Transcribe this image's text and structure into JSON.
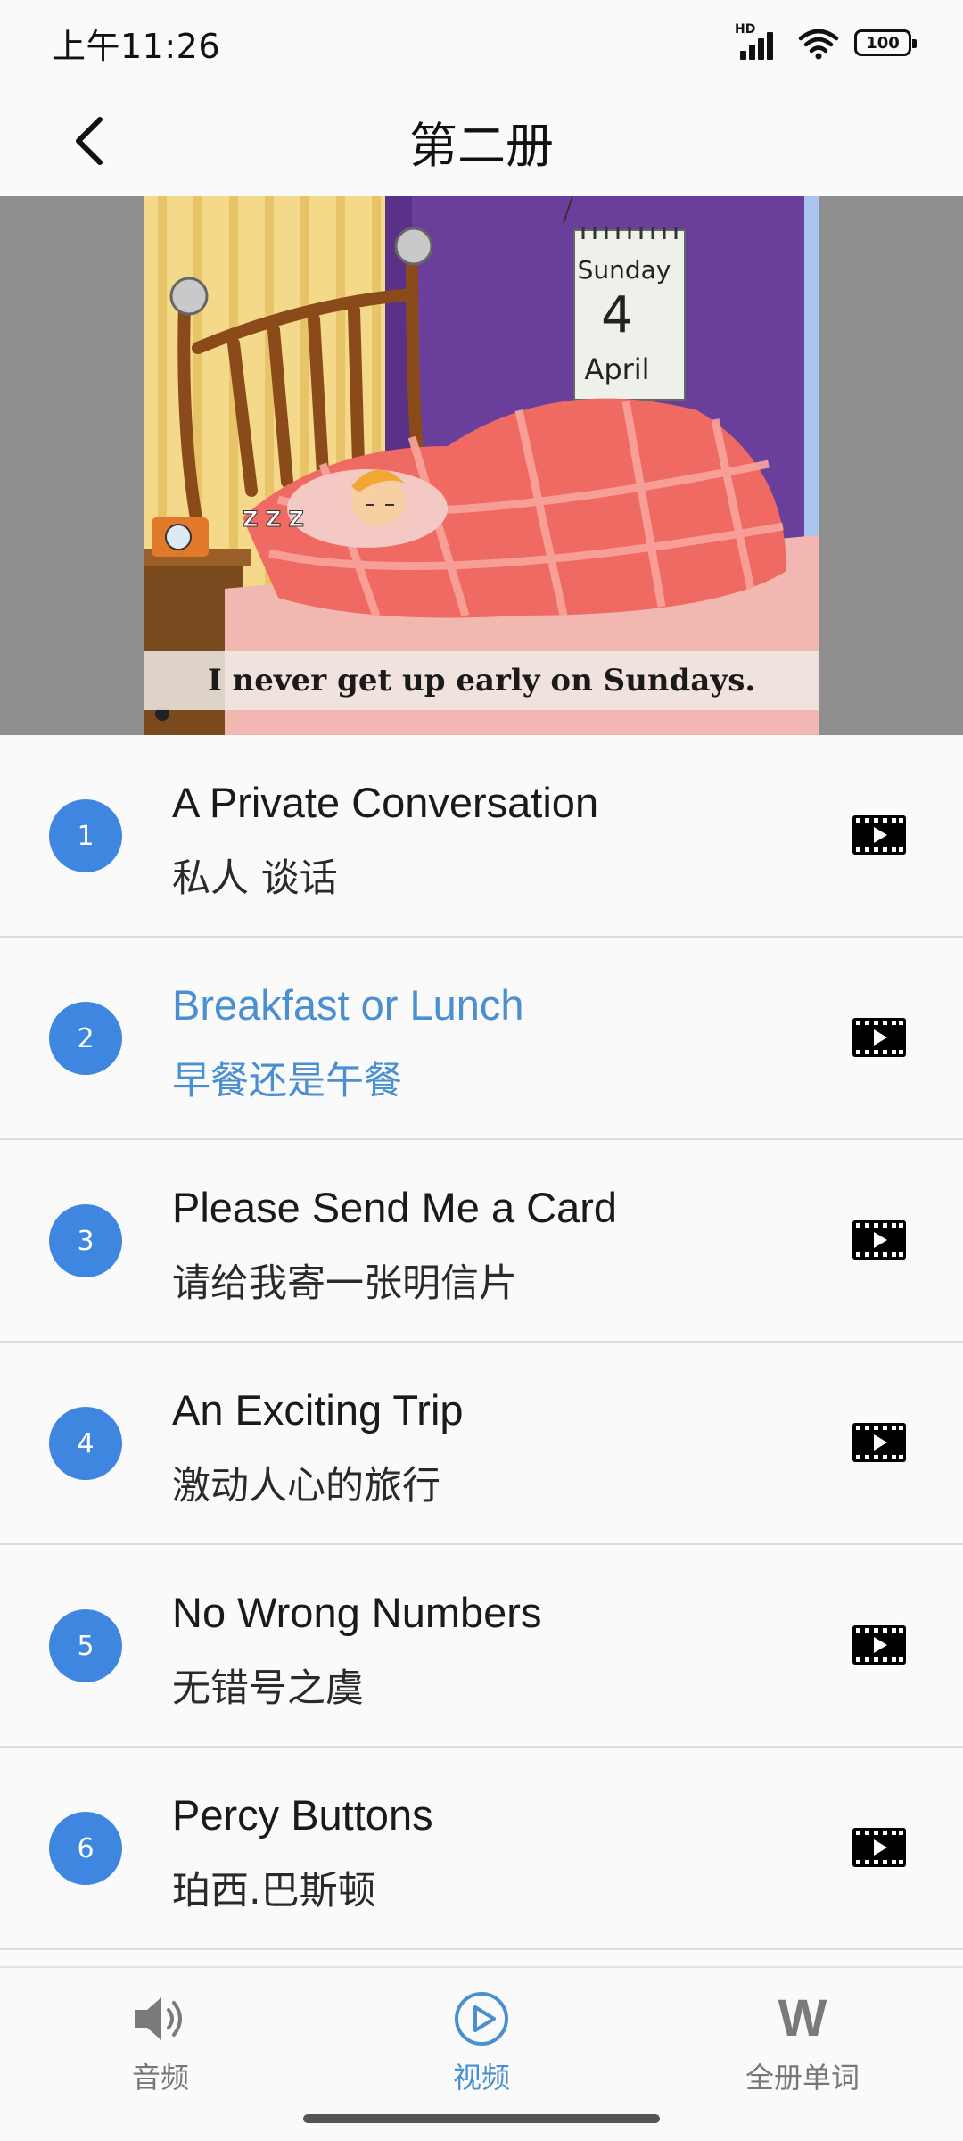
{
  "status_bar": {
    "time": "上午11:26",
    "network_label": "HD",
    "battery": "100"
  },
  "header": {
    "title": "第二册",
    "back_icon": "chevron-left-icon"
  },
  "video": {
    "subtitle": "I never get up early on Sundays.",
    "calendar_day": "Sunday",
    "calendar_date": "4",
    "calendar_month": "April",
    "sleep_text": "Z Z Z"
  },
  "lessons": [
    {
      "number": "1",
      "title_en": "A Private Conversation",
      "title_zh": "私人 谈话",
      "active": false
    },
    {
      "number": "2",
      "title_en": "Breakfast or Lunch",
      "title_zh": "早餐还是午餐",
      "active": true
    },
    {
      "number": "3",
      "title_en": "Please Send Me a Card",
      "title_zh": "请给我寄一张明信片",
      "active": false
    },
    {
      "number": "4",
      "title_en": "An Exciting Trip",
      "title_zh": "激动人心的旅行",
      "active": false
    },
    {
      "number": "5",
      "title_en": "No Wrong Numbers",
      "title_zh": "无错号之虞",
      "active": false
    },
    {
      "number": "6",
      "title_en": "Percy Buttons",
      "title_zh": "珀西.巴斯顿",
      "active": false
    }
  ],
  "bottom_nav": {
    "audio": {
      "label": "音频",
      "icon": "speaker-icon"
    },
    "video": {
      "label": "视频",
      "icon": "play-circle-icon",
      "active": true
    },
    "words": {
      "label": "全册单词",
      "icon": "w-letter-icon",
      "glyph": "W"
    }
  },
  "colors": {
    "accent": "#4a8fcf",
    "badge": "#3f86e0",
    "text": "#1a1a1a",
    "inactive": "#777777"
  }
}
